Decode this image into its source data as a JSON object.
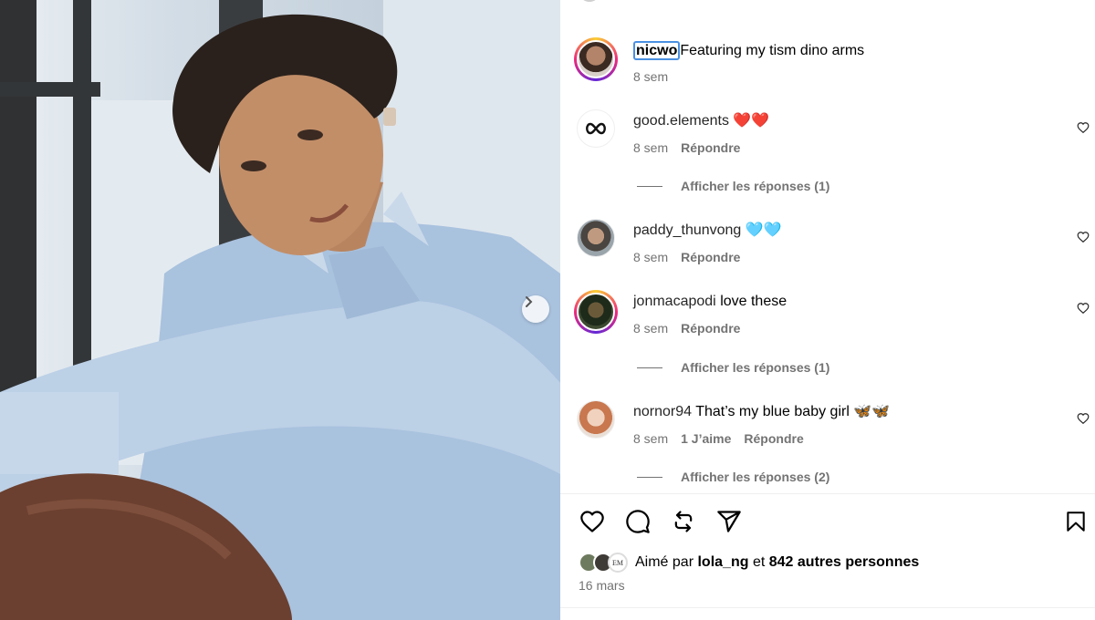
{
  "post": {
    "caption_user": "nicwo",
    "caption_text": "Featuring my tism dino arms",
    "caption_time": "8 sem"
  },
  "comments": [
    {
      "user": "good.elements",
      "text": "❤️❤️",
      "time": "8 sem",
      "likes": "",
      "reply": "Répondre",
      "view_replies": "Afficher les réponses (1)"
    },
    {
      "user": "paddy_thunvong",
      "text": "🩵🩵",
      "time": "8 sem",
      "likes": "",
      "reply": "Répondre",
      "view_replies": ""
    },
    {
      "user": "jonmacapodi",
      "text": "love these",
      "time": "8 sem",
      "likes": "",
      "reply": "Répondre",
      "view_replies": "Afficher les réponses (1)"
    },
    {
      "user": "nornor94",
      "text": "That’s my blue baby girl 🦋🦋",
      "time": "8 sem",
      "likes": "1 J’aime",
      "reply": "Répondre",
      "view_replies": "Afficher les réponses (2)"
    }
  ],
  "likes_bar": {
    "prefix": "Aimé par",
    "user": "lola_ng",
    "middle": "et",
    "others": "842 autres personnes",
    "date": "16 mars"
  },
  "icons": {
    "like": "heart-icon",
    "comment": "comment-icon",
    "repost": "repost-icon",
    "share": "send-icon",
    "save": "bookmark-icon",
    "next": "chevron-right-icon"
  },
  "colors": {
    "meta_text": "#737373",
    "focus_ring": "#4a90e2"
  }
}
